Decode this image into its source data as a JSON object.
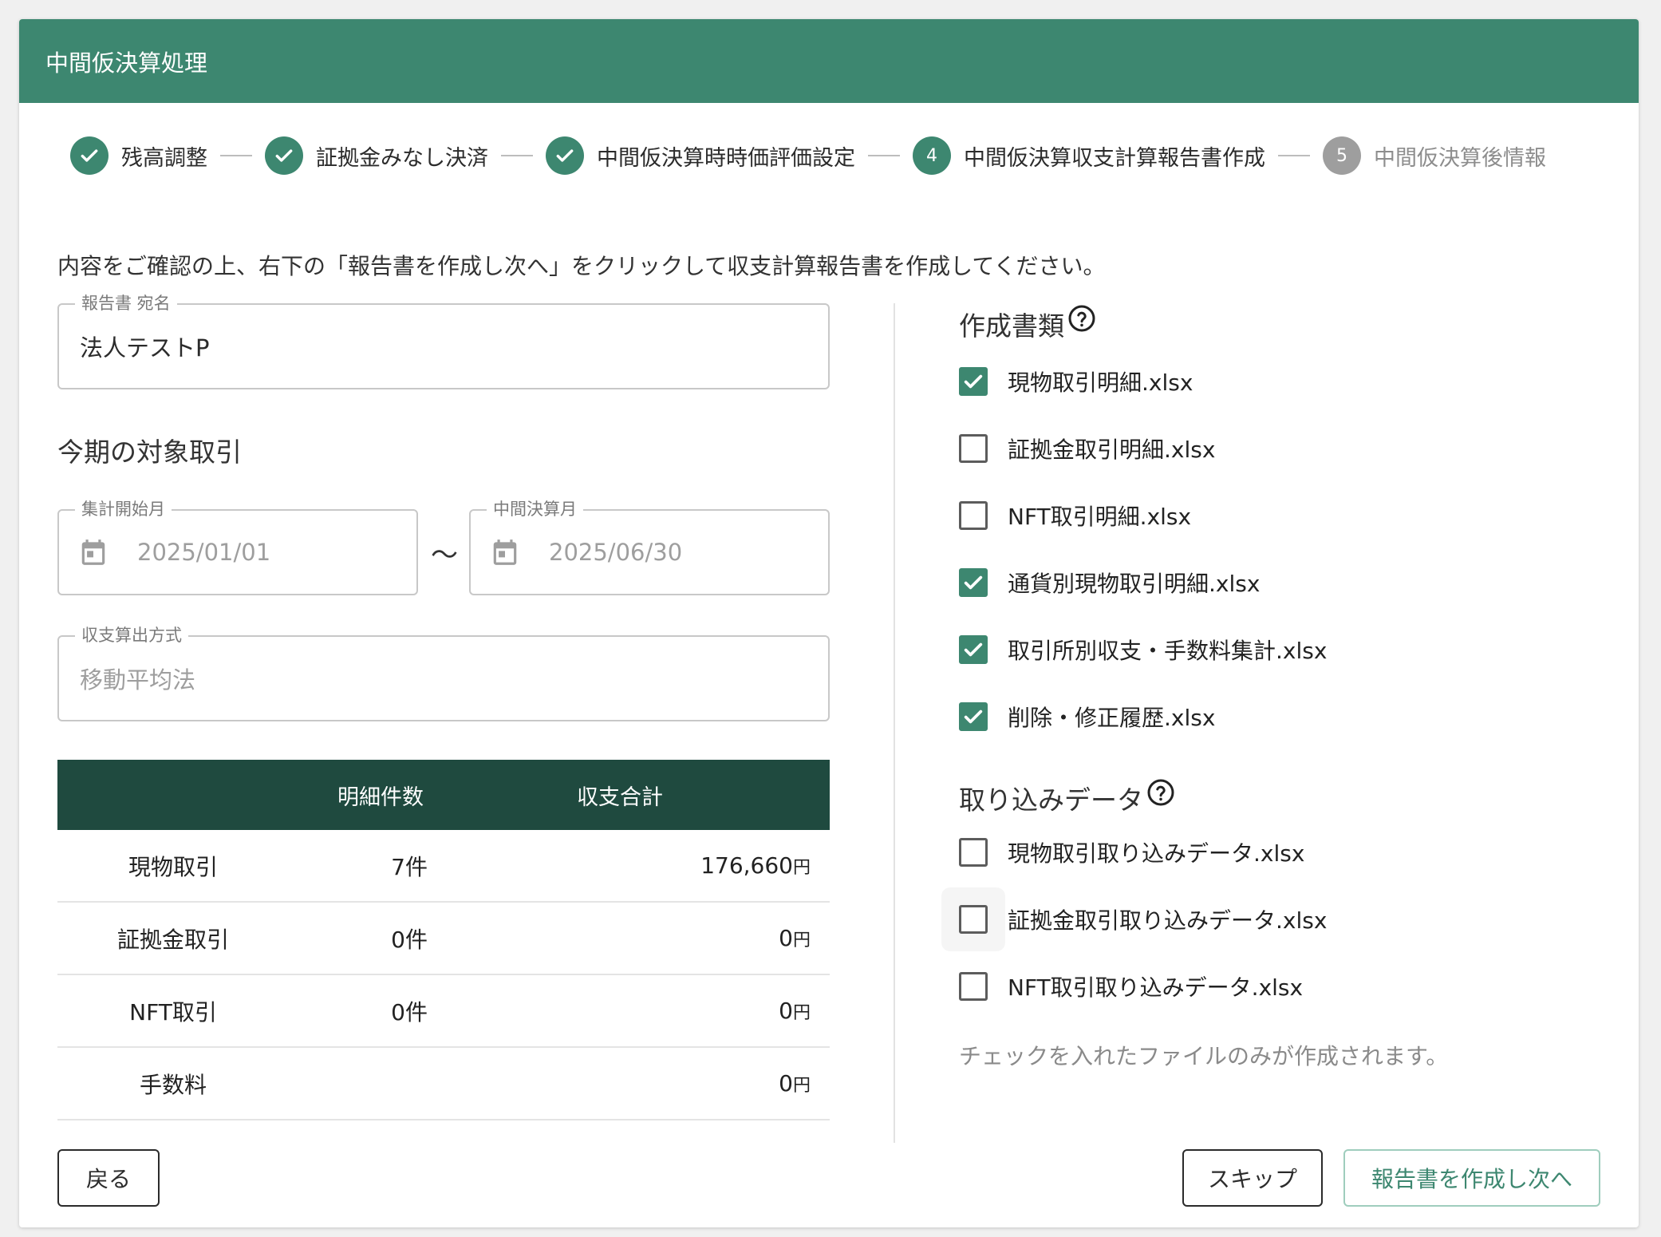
{
  "header": {
    "title": "中間仮決算処理"
  },
  "stepper": {
    "steps": [
      {
        "label": "残高調整",
        "state": "done",
        "number": ""
      },
      {
        "label": "証拠金みなし決済",
        "state": "done",
        "number": ""
      },
      {
        "label": "中間仮決算時時価評価設定",
        "state": "done",
        "number": ""
      },
      {
        "label": "中間仮決算収支計算報告書作成",
        "state": "active",
        "number": "4"
      },
      {
        "label": "中間仮決算後情報",
        "state": "upcoming",
        "number": "5"
      }
    ]
  },
  "instruction": "内容をご確認の上、右下の「報告書を作成し次へ」をクリックして収支計算報告書を作成してください。",
  "report_name": {
    "legend": "報告書 宛名",
    "value": "法人テストP"
  },
  "period_section": {
    "title": "今期の対象取引",
    "start": {
      "legend": "集計開始月",
      "value": "2025/01/01",
      "icon": "calendar-icon"
    },
    "separator": "〜",
    "end": {
      "legend": "中間決算月",
      "value": "2025/06/30",
      "icon": "calendar-icon"
    },
    "method": {
      "legend": "収支算出方式",
      "value": "移動平均法"
    }
  },
  "summary_table": {
    "headers": [
      "",
      "明細件数",
      "収支合計"
    ],
    "rows": [
      {
        "name": "現物取引",
        "count": "7件",
        "total": "176,660",
        "unit": "円"
      },
      {
        "name": "証拠金取引",
        "count": "0件",
        "total": "0",
        "unit": "円"
      },
      {
        "name": "NFT取引",
        "count": "0件",
        "total": "0",
        "unit": "円"
      },
      {
        "name": "手数料",
        "count": "",
        "total": "0",
        "unit": "円"
      }
    ]
  },
  "documents": {
    "title": "作成書類",
    "help_icon": "help-circle-icon",
    "items": [
      {
        "label": "現物取引明細.xlsx",
        "checked": true
      },
      {
        "label": "証拠金取引明細.xlsx",
        "checked": false
      },
      {
        "label": "NFT取引明細.xlsx",
        "checked": false
      },
      {
        "label": "通貨別現物取引明細.xlsx",
        "checked": true
      },
      {
        "label": "取引所別収支・手数料集計.xlsx",
        "checked": true
      },
      {
        "label": "削除・修正履歴.xlsx",
        "checked": true
      }
    ]
  },
  "imports": {
    "title": "取り込みデータ",
    "help_icon": "help-circle-icon",
    "items": [
      {
        "label": "現物取引取り込みデータ.xlsx",
        "checked": false
      },
      {
        "label": "証拠金取引取り込みデータ.xlsx",
        "checked": false
      },
      {
        "label": "NFT取引取り込みデータ.xlsx",
        "checked": false
      }
    ],
    "note": "チェックを入れたファイルのみが作成されます。"
  },
  "buttons": {
    "back": "戻る",
    "skip": "スキップ",
    "next": "報告書を作成し次へ"
  },
  "colors": {
    "primary": "#3d8770",
    "table_header": "#1f4a3f",
    "upcoming": "#9e9e9e"
  }
}
